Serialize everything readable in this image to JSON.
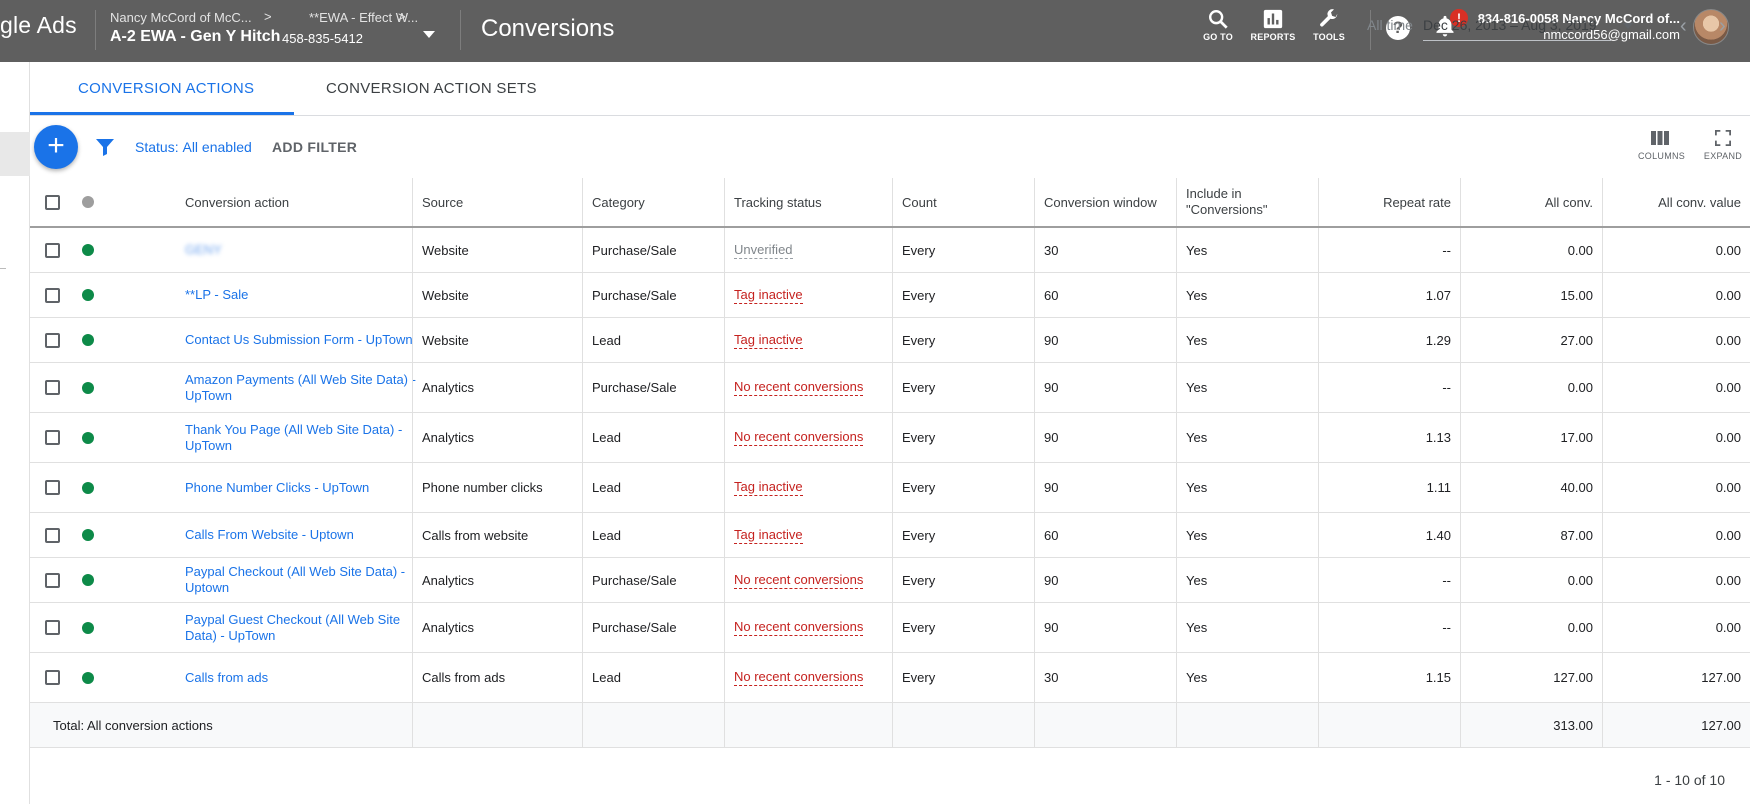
{
  "header": {
    "brand": "gle Ads",
    "breadcrumb": [
      "Nancy McCord of McC...",
      "**EWA - Effect W..."
    ],
    "account_name": "A-2 EWA - Gen Y Hitch",
    "account_id": "458-835-5412",
    "page_title": "Conversions",
    "tools": [
      {
        "label": "GO TO",
        "icon": "search-icon"
      },
      {
        "label": "REPORTS",
        "icon": "reports-icon"
      },
      {
        "label": "TOOLS",
        "icon": "wrench-icon"
      }
    ],
    "notification_badge": "!",
    "user_line1": "834-816-0058 Nancy McCord of...",
    "user_line2": "nmccord56@gmail.com"
  },
  "tabs": [
    {
      "label": "CONVERSION ACTIONS",
      "active": true
    },
    {
      "label": "CONVERSION ACTION SETS",
      "active": false
    }
  ],
  "date_range": {
    "label": "All time",
    "value": "Dec 26, 2013 – Aug 3, 2019"
  },
  "toolbar": {
    "status_label": "Status:",
    "status_value": "All enabled",
    "add_filter": "ADD FILTER",
    "columns": "COLUMNS",
    "expand": "EXPAND"
  },
  "table": {
    "columns": [
      "Conversion action",
      "Source",
      "Category",
      "Tracking status",
      "Count",
      "Conversion window",
      "Include in \"Conversions\"",
      "Repeat rate",
      "All conv.",
      "All conv. value"
    ],
    "rows": [
      {
        "name": "GENY",
        "blurred": true,
        "source": "Website",
        "category": "Purchase/Sale",
        "tracking": "Unverified",
        "tracking_type": "grey",
        "count": "Every",
        "window": "30",
        "include": "Yes",
        "repeat": "--",
        "all_conv": "0.00",
        "value": "0.00"
      },
      {
        "name": "**LP - Sale",
        "source": "Website",
        "category": "Purchase/Sale",
        "tracking": "Tag inactive",
        "tracking_type": "red",
        "count": "Every",
        "window": "60",
        "include": "Yes",
        "repeat": "1.07",
        "all_conv": "15.00",
        "value": "0.00"
      },
      {
        "name": "Contact Us Submission Form - UpTown",
        "source": "Website",
        "category": "Lead",
        "tracking": "Tag inactive",
        "tracking_type": "red",
        "count": "Every",
        "window": "90",
        "include": "Yes",
        "repeat": "1.29",
        "all_conv": "27.00",
        "value": "0.00"
      },
      {
        "name": "Amazon Payments (All Web Site Data) - UpTown",
        "source": "Analytics",
        "category": "Purchase/Sale",
        "tracking": "No recent conversions",
        "tracking_type": "red",
        "count": "Every",
        "window": "90",
        "include": "Yes",
        "repeat": "--",
        "all_conv": "0.00",
        "value": "0.00"
      },
      {
        "name": "Thank You Page (All Web Site Data) - UpTown",
        "source": "Analytics",
        "category": "Lead",
        "tracking": "No recent conversions",
        "tracking_type": "red",
        "count": "Every",
        "window": "90",
        "include": "Yes",
        "repeat": "1.13",
        "all_conv": "17.00",
        "value": "0.00"
      },
      {
        "name": "Phone Number Clicks - UpTown",
        "source": "Phone number clicks",
        "category": "Lead",
        "tracking": "Tag inactive",
        "tracking_type": "red",
        "count": "Every",
        "window": "90",
        "include": "Yes",
        "repeat": "1.11",
        "all_conv": "40.00",
        "value": "0.00"
      },
      {
        "name": "Calls From Website - Uptown",
        "source": "Calls from website",
        "category": "Lead",
        "tracking": "Tag inactive",
        "tracking_type": "red",
        "count": "Every",
        "window": "60",
        "include": "Yes",
        "repeat": "1.40",
        "all_conv": "87.00",
        "value": "0.00"
      },
      {
        "name": "Paypal Checkout (All Web Site Data) - Uptown",
        "source": "Analytics",
        "category": "Purchase/Sale",
        "tracking": "No recent conversions",
        "tracking_type": "red",
        "count": "Every",
        "window": "90",
        "include": "Yes",
        "repeat": "--",
        "all_conv": "0.00",
        "value": "0.00"
      },
      {
        "name": "Paypal Guest Checkout (All Web Site Data) - UpTown",
        "source": "Analytics",
        "category": "Purchase/Sale",
        "tracking": "No recent conversions",
        "tracking_type": "red",
        "count": "Every",
        "window": "90",
        "include": "Yes",
        "repeat": "--",
        "all_conv": "0.00",
        "value": "0.00"
      },
      {
        "name": "Calls from ads",
        "source": "Calls from ads",
        "category": "Lead",
        "tracking": "No recent conversions",
        "tracking_type": "red",
        "count": "Every",
        "window": "30",
        "include": "Yes",
        "repeat": "1.15",
        "all_conv": "127.00",
        "value": "127.00"
      }
    ],
    "total": {
      "label": "Total: All conversion actions",
      "all_conv": "313.00",
      "value": "127.00"
    }
  },
  "pagination": "1 - 10 of 10",
  "colors": {
    "accent": "#1a73e8",
    "status_enabled": "#0d8a48",
    "error": "#c5221f",
    "topbar": "#5f5f5f"
  }
}
